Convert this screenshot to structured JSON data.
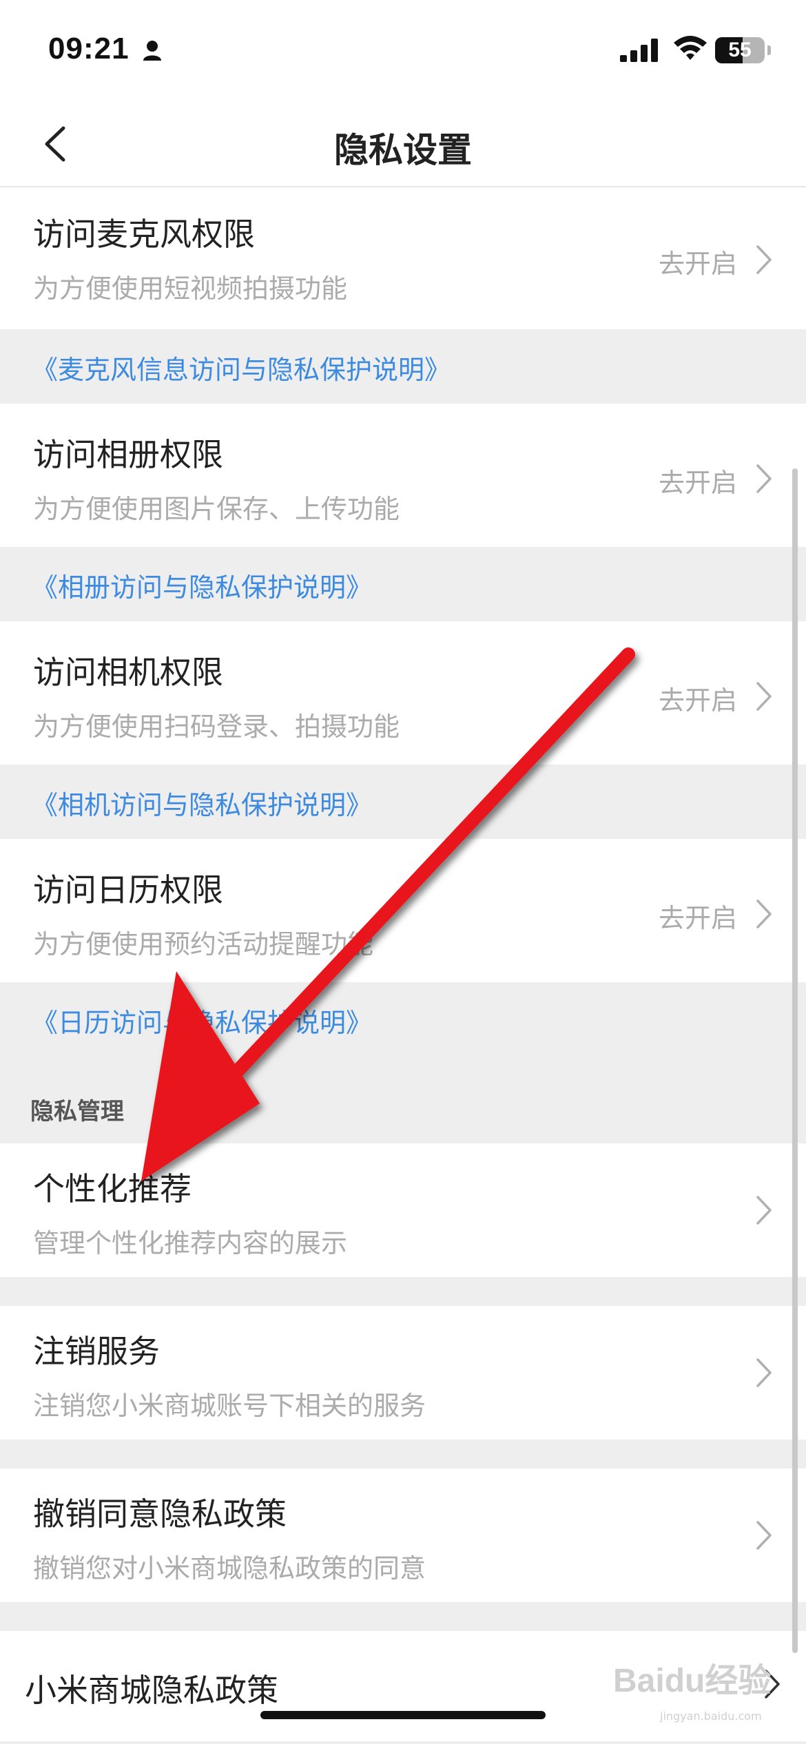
{
  "status": {
    "time": "09:21",
    "battery": "55",
    "battery_level": 0.55
  },
  "nav": {
    "title": "隐私设置"
  },
  "permissions": [
    {
      "title": "访问麦克风权限",
      "subtitle": "为方便使用短视频拍摄功能",
      "action": "去开启",
      "note": "《麦克风信息访问与隐私保护说明》"
    },
    {
      "title": "访问相册权限",
      "subtitle": "为方便使用图片保存、上传功能",
      "action": "去开启",
      "note": "《相册访问与隐私保护说明》"
    },
    {
      "title": "访问相机权限",
      "subtitle": "为方便使用扫码登录、拍摄功能",
      "action": "去开启",
      "note": "《相机访问与隐私保护说明》"
    },
    {
      "title": "访问日历权限",
      "subtitle": "为方便使用预约活动提醒功能",
      "action": "去开启",
      "note": "《日历访问与隐私保护说明》"
    }
  ],
  "section": {
    "label": "隐私管理"
  },
  "management": [
    {
      "title": "个性化推荐",
      "subtitle": "管理个性化推荐内容的展示"
    },
    {
      "title": "注销服务",
      "subtitle": "注销您小米商城账号下相关的服务"
    },
    {
      "title": "撤销同意隐私政策",
      "subtitle": "撤销您对小米商城隐私政策的同意"
    }
  ],
  "policy": {
    "title": "小米商城隐私政策"
  },
  "watermark": {
    "text": "Baidu经验",
    "sub": "jingyan.baidu.com"
  },
  "colors": {
    "link": "#3c8be0",
    "annotation_arrow": "#e8141b",
    "background": "#eeeeee"
  }
}
